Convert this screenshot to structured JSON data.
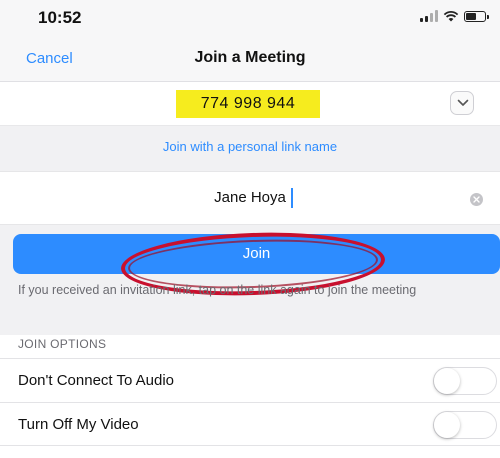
{
  "status_bar": {
    "time": "10:52"
  },
  "nav": {
    "cancel_label": "Cancel",
    "title": "Join a Meeting"
  },
  "meeting": {
    "id_value": "774 998 944",
    "dropdown_icon": "chevron-down-icon"
  },
  "personal_link": {
    "label": "Join with a personal link name"
  },
  "name_field": {
    "value": "Jane Hoya",
    "clear_icon": "clear-icon"
  },
  "join": {
    "label": "Join",
    "hint": "If you received an invitation link, tap on the link again to join the meeting",
    "annotation_color": "#c8102e"
  },
  "options": {
    "header": "JOIN OPTIONS",
    "items": [
      {
        "label": "Don't Connect To Audio",
        "enabled": false
      },
      {
        "label": "Turn Off My Video",
        "enabled": false
      }
    ]
  },
  "colors": {
    "accent": "#2d8cff",
    "highlight": "#f6ec1e"
  }
}
